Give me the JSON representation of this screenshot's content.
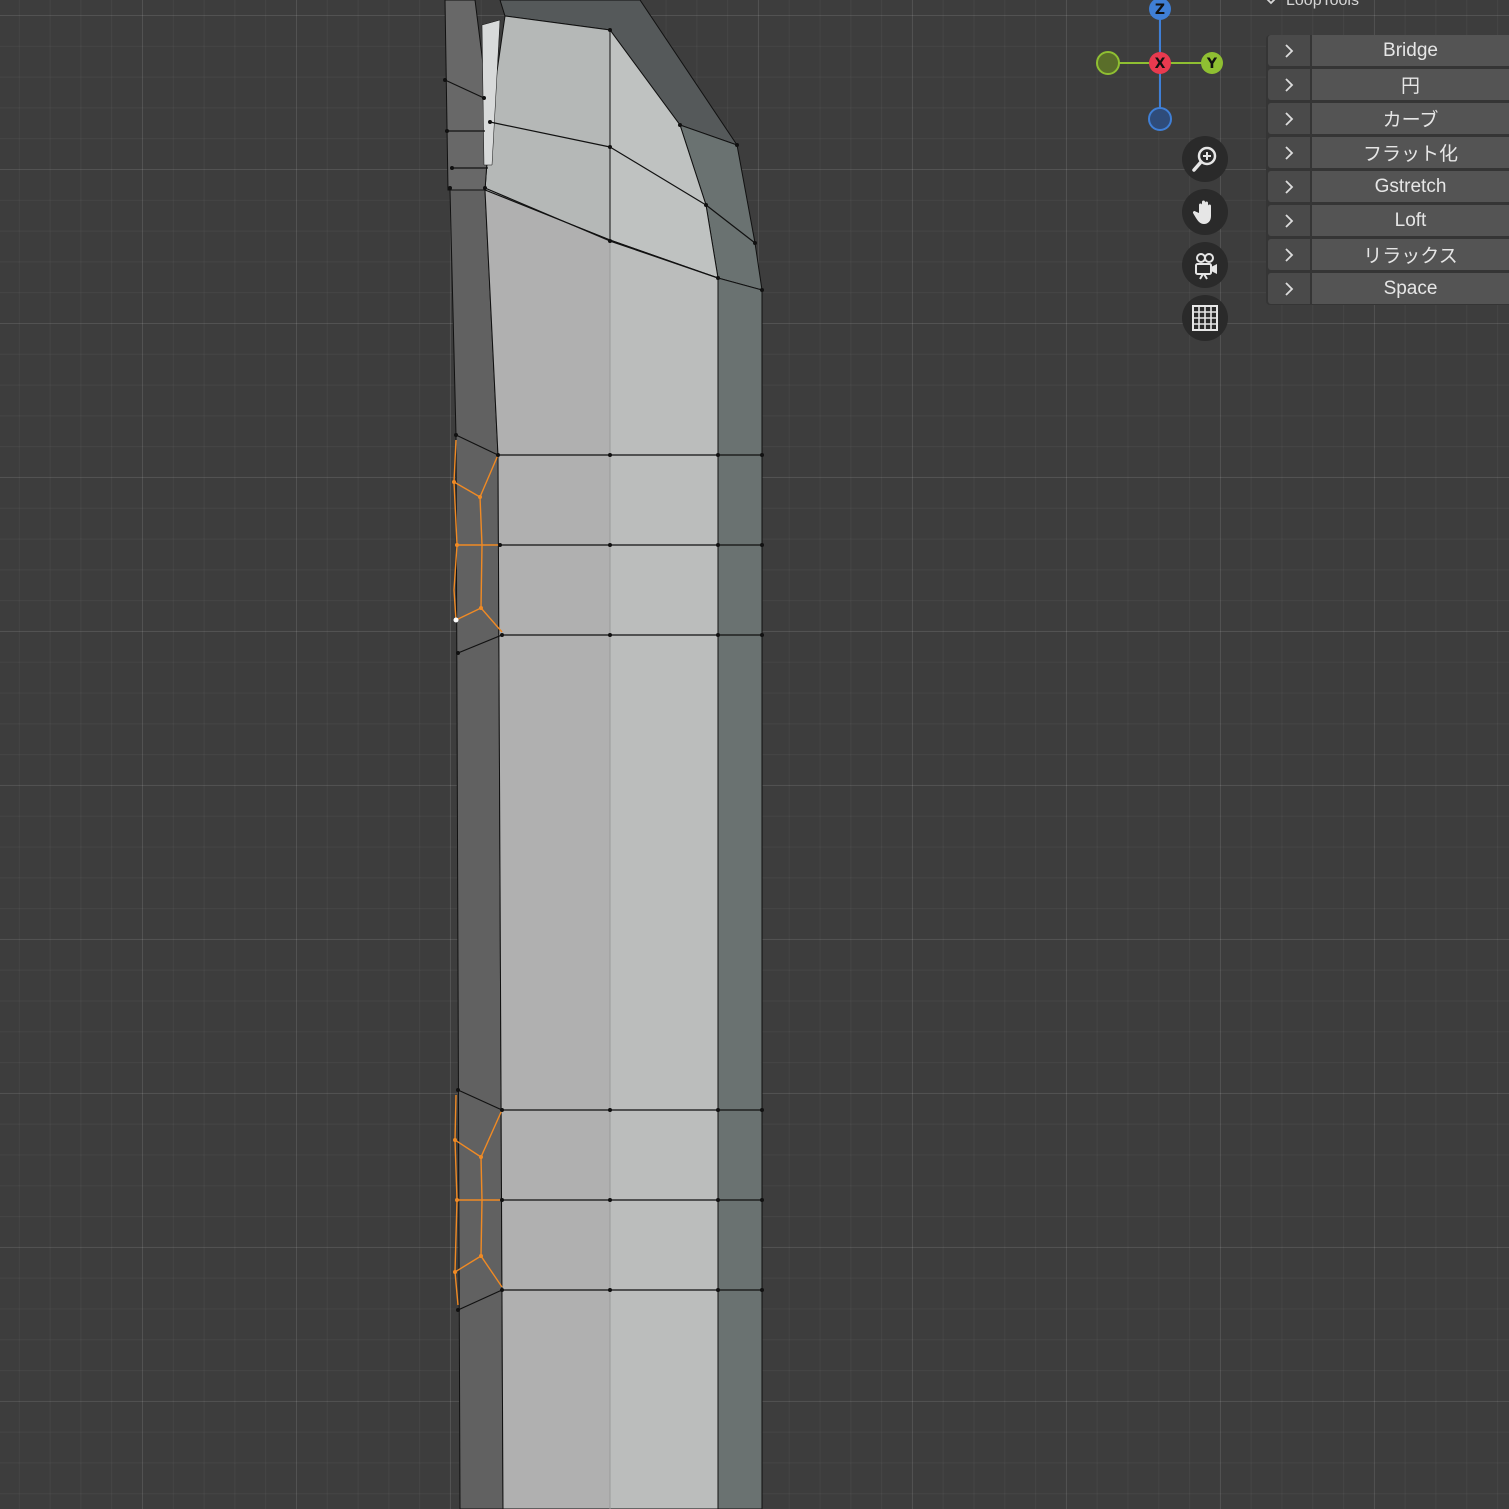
{
  "viewport": {
    "background_color": "#3d3d3d",
    "selection_color": "#f08a24"
  },
  "gizmo": {
    "axes": [
      {
        "label": "Z",
        "color": "#3f7fd6"
      },
      {
        "label": "X",
        "color": "#e83a4f"
      },
      {
        "label": "Y",
        "color": "#8fbf32"
      }
    ]
  },
  "nav_buttons": [
    {
      "icon": "zoom-icon"
    },
    {
      "icon": "hand-pan-icon"
    },
    {
      "icon": "camera-icon"
    },
    {
      "icon": "grid-icon"
    }
  ],
  "panel": {
    "title": "LoopTools",
    "items": [
      {
        "label": "Bridge"
      },
      {
        "label": "円"
      },
      {
        "label": "カーブ"
      },
      {
        "label": "フラット化"
      },
      {
        "label": "Gstretch"
      },
      {
        "label": "Loft"
      },
      {
        "label": "リラックス"
      },
      {
        "label": "Space"
      }
    ]
  }
}
